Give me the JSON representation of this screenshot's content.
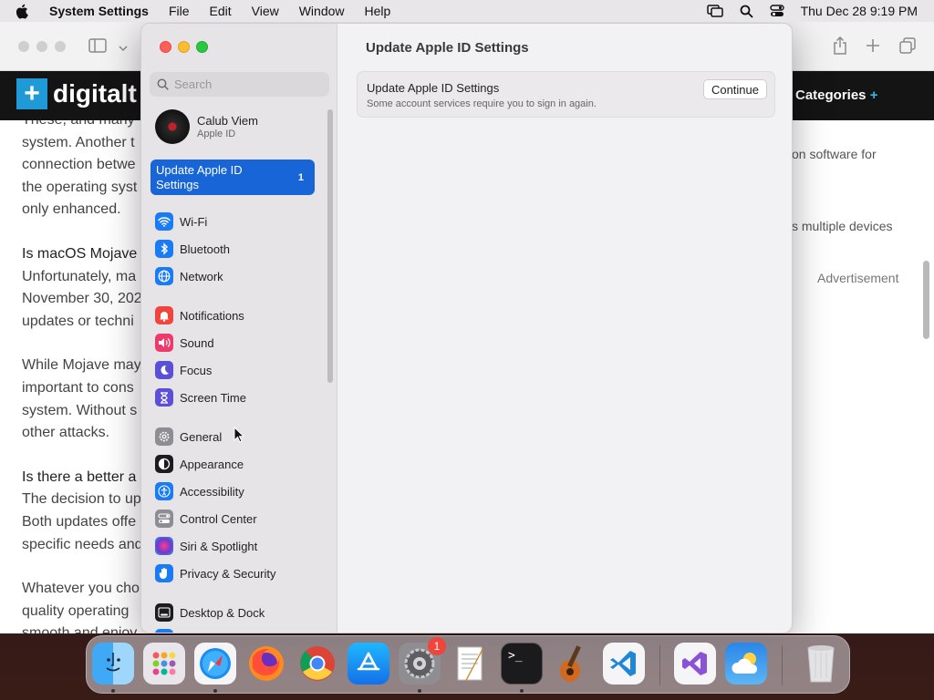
{
  "menubar": {
    "app_name": "System Settings",
    "menus": [
      "File",
      "Edit",
      "View",
      "Window",
      "Help"
    ],
    "clock": "Thu Dec 28  9:19 PM"
  },
  "safari": {
    "logo_text": "digitalt",
    "categories_label": "Categories",
    "categories_plus": "+",
    "article_paragraphs": [
      [
        "These, and many",
        "system. Another t",
        "connection betwe",
        "the operating syst",
        "only enhanced."
      ],
      [
        "Is macOS Mojave",
        "Unfortunately, ma",
        "November 30, 202",
        "updates or techni"
      ],
      [
        "While Mojave may",
        "important to cons",
        "system. Without s",
        "other attacks."
      ],
      [
        "Is there a better a",
        "The decision to up",
        "Both updates offe",
        "specific needs and"
      ],
      [
        "Whatever you cho",
        "quality operating",
        "smooth and enjoy"
      ]
    ],
    "right_snippets": [
      "on software for",
      "s multiple devices",
      "Advertisement"
    ]
  },
  "settings": {
    "search_placeholder": "Search",
    "account": {
      "name": "Calub Viem",
      "subtitle": "Apple ID"
    },
    "selected_item": {
      "label": "Update Apple ID Settings",
      "badge": "1"
    },
    "sidebar_items": [
      {
        "label": "Wi-Fi",
        "icon": "wifi-icon",
        "color": "#1a7cf5"
      },
      {
        "label": "Bluetooth",
        "icon": "bluetooth-icon",
        "color": "#1a7cf5"
      },
      {
        "label": "Network",
        "icon": "globe-icon",
        "color": "#1a7cf5"
      },
      {
        "label": "Notifications",
        "icon": "bell-icon",
        "color": "#f0443c"
      },
      {
        "label": "Sound",
        "icon": "speaker-icon",
        "color": "#ee3a6a"
      },
      {
        "label": "Focus",
        "icon": "moon-icon",
        "color": "#5b4fd6"
      },
      {
        "label": "Screen Time",
        "icon": "hourglass-icon",
        "color": "#5b4fd6"
      },
      {
        "label": "General",
        "icon": "gear-icon",
        "color": "#8e8d91"
      },
      {
        "label": "Appearance",
        "icon": "appearance-icon",
        "color": "#1c1c1e"
      },
      {
        "label": "Accessibility",
        "icon": "accessibility-icon",
        "color": "#1a7cf5"
      },
      {
        "label": "Control Center",
        "icon": "toggles-icon",
        "color": "#8e8d91"
      },
      {
        "label": "Siri & Spotlight",
        "icon": "siri-icon",
        "color": "#6a3ad1"
      },
      {
        "label": "Privacy & Security",
        "icon": "hand-icon",
        "color": "#1a7cf5"
      },
      {
        "label": "Desktop & Dock",
        "icon": "dock-icon",
        "color": "#1c1c1e"
      }
    ],
    "content": {
      "title": "Update Apple ID Settings",
      "card_title": "Update Apple ID Settings",
      "card_subtitle": "Some account services require you to sign in again.",
      "continue_label": "Continue"
    }
  },
  "dock": {
    "apps": [
      "finder-icon",
      "launchpad-icon",
      "safari-icon",
      "firefox-icon",
      "chrome-icon",
      "app-store-icon",
      "system-settings-icon",
      "textedit-icon",
      "terminal-icon",
      "garageband-icon",
      "vscode-icon",
      "visual-studio-icon",
      "weather-icon",
      "trash-icon"
    ],
    "settings_badge": "1"
  }
}
